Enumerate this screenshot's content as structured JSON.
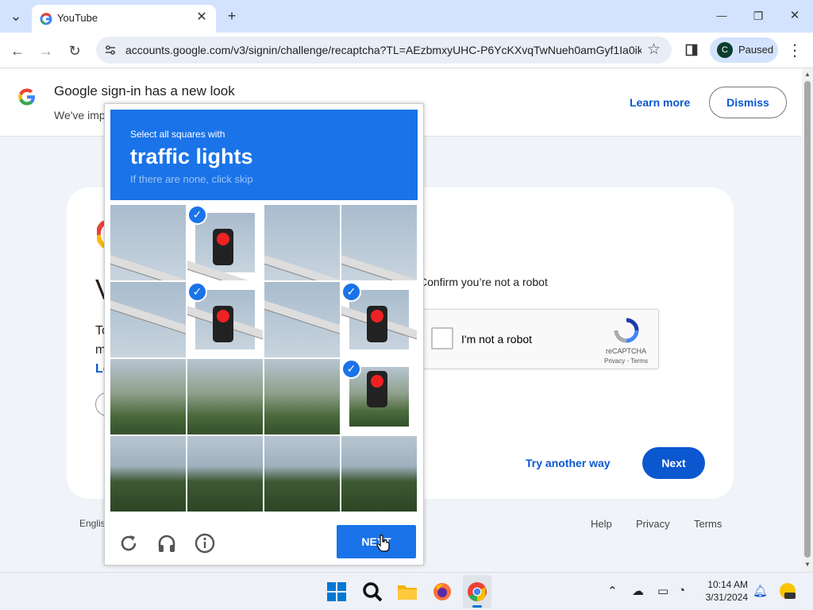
{
  "browser": {
    "tab_title": "YouTube",
    "url": "accounts.google.com/v3/signin/challenge/recaptcha?TL=AEzbmxyUHC-P6YcKXvqTwNueh0amGyf1Ia0ik...",
    "profile_initial": "C",
    "profile_status": "Paused",
    "new_tab": "+",
    "close_tab": "✕",
    "minimize": "—",
    "restore": "❐",
    "close_window": "✕",
    "tab_list": "⌄",
    "back": "←",
    "forward": "→",
    "reload": "↻",
    "star": "☆",
    "menu": "⋮"
  },
  "banner": {
    "title": "Google sign-in has a new look",
    "subtitle": "We've imp",
    "learn_more": "Learn more",
    "dismiss": "Dismiss"
  },
  "signin": {
    "partial_heading": "V",
    "partial_lines": [
      "To",
      "m",
      "Le"
    ],
    "confirm_text": "Confirm you’re not a robot",
    "checkbox_label": "I'm not a robot",
    "recaptcha_brand": "reCAPTCHA",
    "recaptcha_links": "Privacy - Terms",
    "try_another": "Try another way",
    "next": "Next"
  },
  "footer": {
    "language": "Englis",
    "help": "Help",
    "privacy": "Privacy",
    "terms": "Terms"
  },
  "captcha": {
    "instruction": "Select all squares with",
    "target": "traffic lights",
    "hint": "If there are none, click skip",
    "verify_button": "NEXT",
    "selected_cells": [
      1,
      5,
      7,
      11
    ]
  },
  "taskbar": {
    "time": "10:14 AM",
    "date": "3/31/2024"
  },
  "colors": {
    "captcha_blue": "#1a73e8",
    "google_blue": "#0b57d0"
  }
}
